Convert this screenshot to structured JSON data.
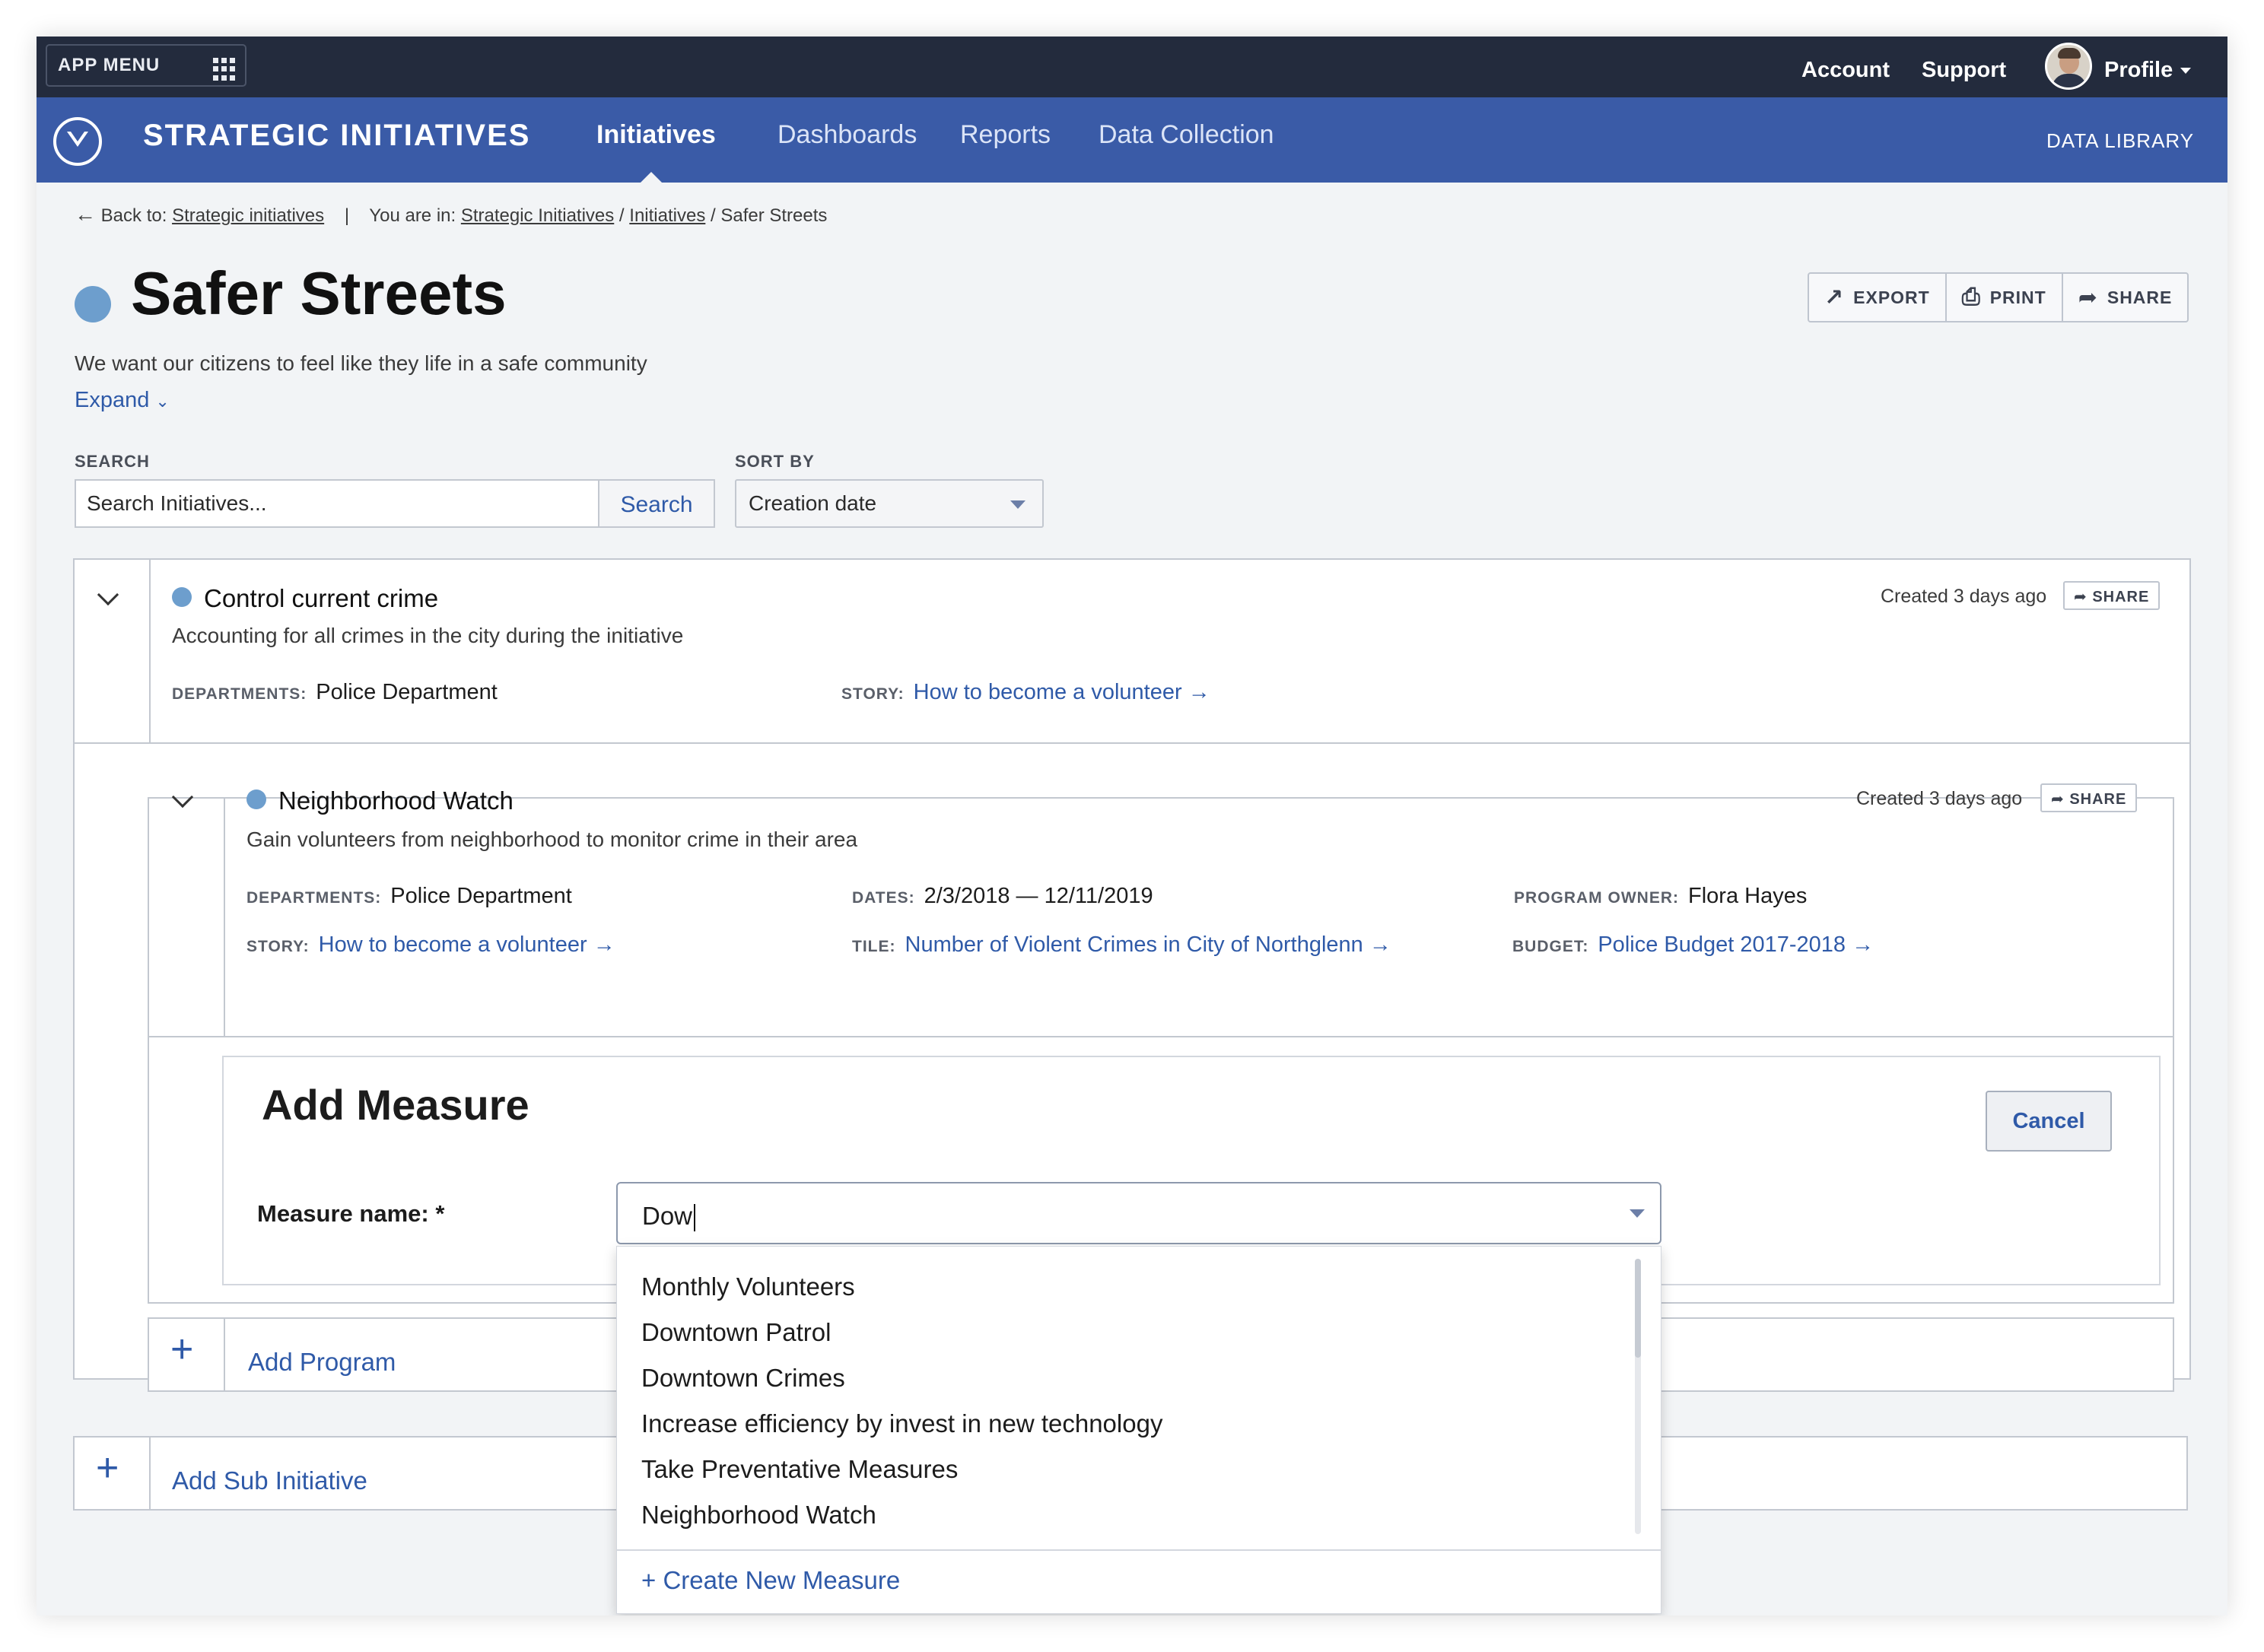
{
  "topbar": {
    "app_menu": "APP MENU",
    "account": "Account",
    "support": "Support",
    "profile": "Profile"
  },
  "navbar": {
    "brand": "STRATEGIC INITIATIVES",
    "items": [
      "Initiatives",
      "Dashboards",
      "Reports",
      "Data Collection"
    ],
    "active": "Initiatives",
    "data_library": "DATA LIBRARY"
  },
  "breadcrumb": {
    "back_prefix": "Back to:",
    "back_link": "Strategic initiatives",
    "separator": "|",
    "you_are_in": "You are in:",
    "path": [
      "Strategic Initiatives",
      "Initiatives"
    ],
    "current": "Safer Streets"
  },
  "page": {
    "title": "Safer Streets",
    "subtitle": "We want our citizens to feel like they life in a safe community",
    "expand": "Expand",
    "status_color": "#6d9ecd"
  },
  "actions": {
    "export": "EXPORT",
    "print": "PRINT",
    "share": "SHARE"
  },
  "search": {
    "label": "SEARCH",
    "placeholder": "Search Initiatives...",
    "button": "Search"
  },
  "sort": {
    "label": "SORT BY",
    "value": "Creation date"
  },
  "initiative": {
    "title": "Control current crime",
    "description": "Accounting for all crimes in the city during the initiative",
    "created": "Created 3 days ago",
    "share": "SHARE",
    "departments_label": "DEPARTMENTS:",
    "departments": "Police Department",
    "story_label": "STORY:",
    "story": "How to become a volunteer"
  },
  "program": {
    "title": "Neighborhood Watch",
    "description": "Gain volunteers from neighborhood to monitor crime in their area",
    "created": "Created 3 days ago",
    "share": "SHARE",
    "departments_label": "DEPARTMENTS:",
    "departments": "Police Department",
    "dates_label": "DATES:",
    "dates": "2/3/2018 — 12/11/2019",
    "owner_label": "PROGRAM OWNER:",
    "owner": "Flora Hayes",
    "story_label": "STORY:",
    "story": "How to become a volunteer",
    "tile_label": "TILE:",
    "tile": "Number of Violent Crimes in City of Northglenn",
    "budget_label": "BUDGET:",
    "budget": "Police Budget 2017-2018"
  },
  "add_measure": {
    "title": "Add Measure",
    "cancel": "Cancel",
    "name_label": "Measure name: *",
    "input_value": "Dow",
    "options": [
      "Monthly Volunteers",
      "Downtown Patrol",
      "Downtown Crimes",
      "Increase efficiency by invest in new technology",
      "Take Preventative Measures",
      "Neighborhood Watch"
    ],
    "create_new": "Create New Measure"
  },
  "add_program": "Add Program",
  "add_sub_initiative": "Add Sub Initiative",
  "colors": {
    "topbar": "#232b3d",
    "navbar": "#3a5ba7",
    "link": "#2f5aa8",
    "status_dot": "#6d9ecd"
  }
}
